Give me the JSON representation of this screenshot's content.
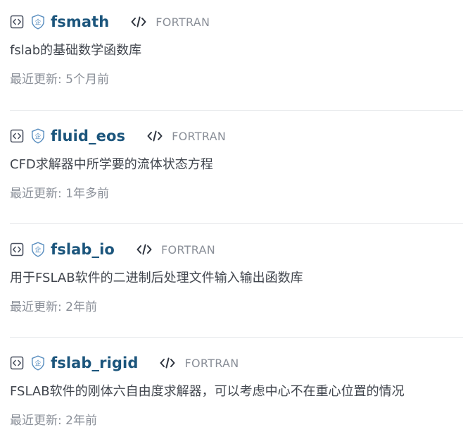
{
  "repos": [
    {
      "name": "fsmath",
      "language": "FORTRAN",
      "description": "fslab的基础数学函数库",
      "updated": "最近更新: 5个月前"
    },
    {
      "name": "fluid_eos",
      "language": "FORTRAN",
      "description": "CFD求解器中所学要的流体状态方程",
      "updated": "最近更新: 1年多前"
    },
    {
      "name": "fslab_io",
      "language": "FORTRAN",
      "description": "用于FSLAB软件的二进制后处理文件输入输出函数库",
      "updated": "最近更新: 2年前"
    },
    {
      "name": "fslab_rigid",
      "language": "FORTRAN",
      "description": "FSLAB软件的刚体六自由度求解器，可以考虑中心不在重心位置的情况",
      "updated": "最近更新: 2年前"
    }
  ],
  "icons": {
    "repo_type": "repo-template-icon",
    "org": "org-badge-icon",
    "language": "code-icon"
  },
  "colors": {
    "repo_name": "#1b557c",
    "language": "#8a8f98",
    "description": "#40454d",
    "updated": "#8a8f98",
    "divider": "#e6e8eb"
  }
}
